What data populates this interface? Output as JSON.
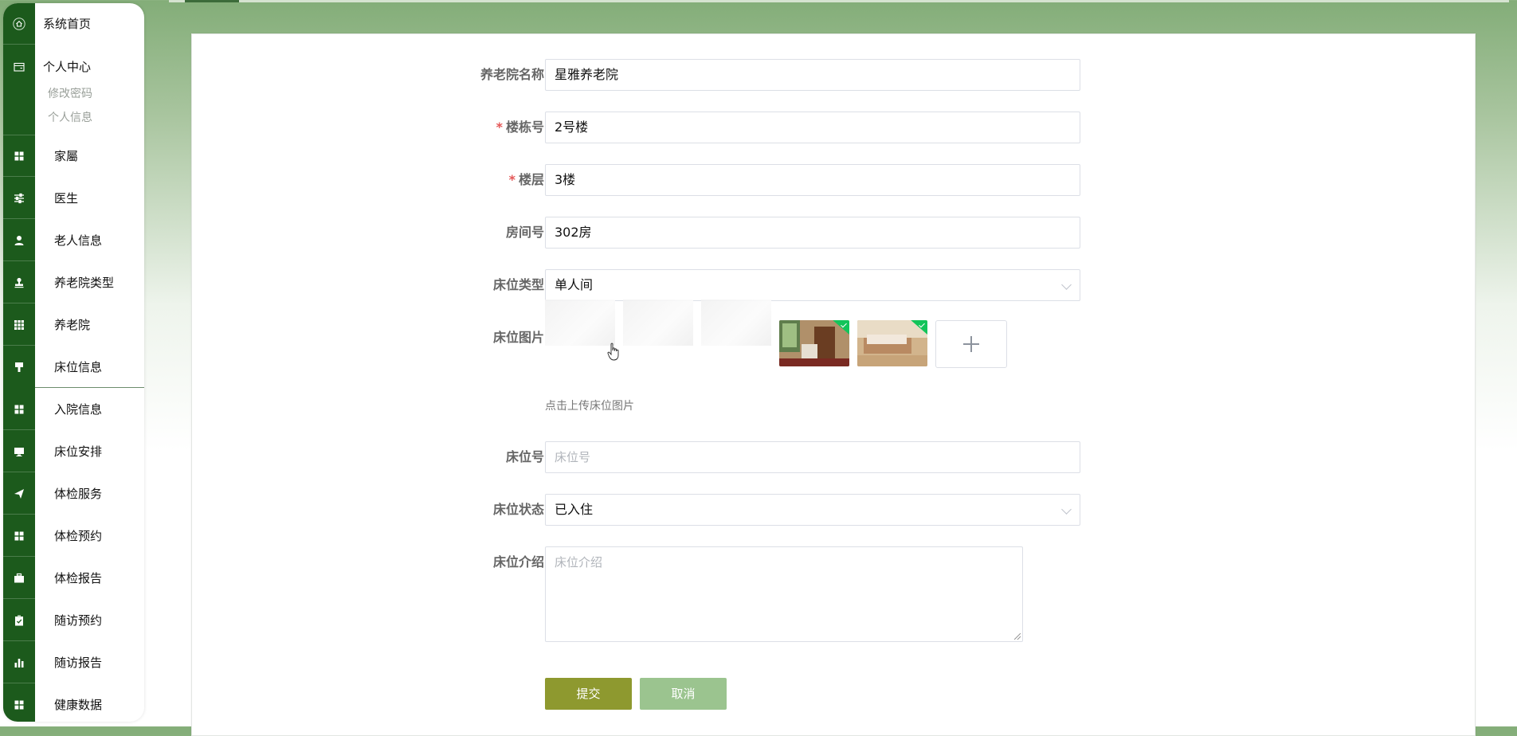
{
  "sidebar": {
    "top_items": [
      {
        "label": "系统首页",
        "icon": "home-icon"
      },
      {
        "label": "个人中心",
        "icon": "wallet-icon"
      }
    ],
    "sub_items": [
      "修改密码",
      "个人信息"
    ],
    "items": [
      {
        "label": "家屬",
        "icon": "grid-icon"
      },
      {
        "label": "医生",
        "icon": "sliders-icon"
      },
      {
        "label": "老人信息",
        "icon": "user-icon"
      },
      {
        "label": "养老院类型",
        "icon": "stamp-icon"
      },
      {
        "label": "养老院",
        "icon": "apps-icon"
      },
      {
        "label": "床位信息",
        "icon": "brush-icon"
      },
      {
        "label": "入院信息",
        "icon": "grid-icon"
      },
      {
        "label": "床位安排",
        "icon": "monitor-icon"
      },
      {
        "label": "体检服务",
        "icon": "send-icon"
      },
      {
        "label": "体检预约",
        "icon": "grid-icon"
      },
      {
        "label": "体检报告",
        "icon": "briefcase-icon"
      },
      {
        "label": "随访预约",
        "icon": "clipboard-icon"
      },
      {
        "label": "随访报告",
        "icon": "bar-chart-icon"
      },
      {
        "label": "健康数据",
        "icon": "grid-icon"
      }
    ]
  },
  "form": {
    "nursing_home_name": {
      "label": "养老院名称",
      "value": "星雅养老院"
    },
    "building": {
      "label": "楼栋号",
      "value": "2号楼",
      "required": "*"
    },
    "floor": {
      "label": "楼层",
      "value": "3楼",
      "required": "*"
    },
    "room": {
      "label": "房间号",
      "value": "302房"
    },
    "bed_type": {
      "label": "床位类型",
      "value": "单人间"
    },
    "bed_image": {
      "label": "床位图片",
      "hint": "点击上传床位图片"
    },
    "bed_no": {
      "label": "床位号",
      "placeholder": "床位号"
    },
    "bed_status": {
      "label": "床位状态",
      "value": "已入住"
    },
    "bed_intro": {
      "label": "床位介绍",
      "placeholder": "床位介绍"
    },
    "submit_label": "提交",
    "cancel_label": "取消"
  },
  "colors": {
    "sidebar_rail": "#1c5a1c",
    "submit": "#8e992f",
    "cancel": "#9bc48f",
    "required": "#e45656",
    "upload_tick": "#13c45a"
  }
}
